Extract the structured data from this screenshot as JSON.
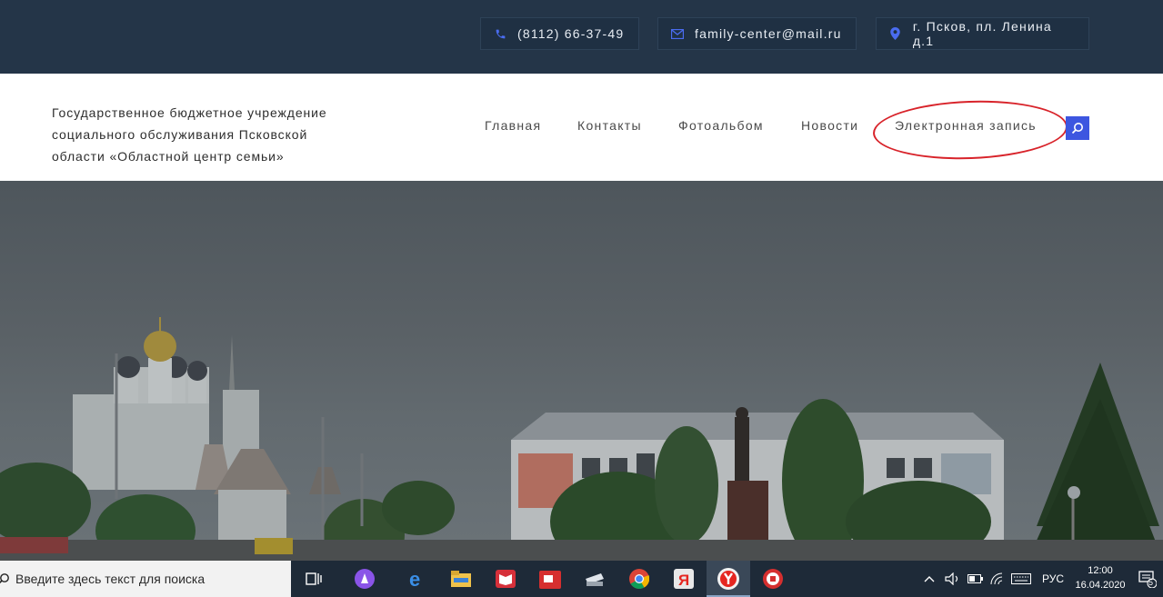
{
  "topbar": {
    "phone": "(8112) 66-37-49",
    "email": "family-center@mail.ru",
    "address": "г. Псков, пл. Ленина д.1"
  },
  "header": {
    "org_line1": "Государственное бюджетное учреждение",
    "org_line2": "социального обслуживания Псковской",
    "org_line3": "области «Областной центр семьи»",
    "nav": [
      "Главная",
      "Контакты",
      "Фотоальбом",
      "Новости",
      "Электронная запись"
    ]
  },
  "taskbar": {
    "search_placeholder": "Введите здесь текст для поиска",
    "language": "РУС",
    "time": "12:00",
    "date": "16.04.2020",
    "notifications_count": "5"
  },
  "colors": {
    "topbar_bg": "#243548",
    "accent_blue": "#3d56e0",
    "annotation_red": "#d8232a"
  },
  "icons": [
    "phone-icon",
    "mail-icon",
    "location-icon",
    "search-icon"
  ]
}
